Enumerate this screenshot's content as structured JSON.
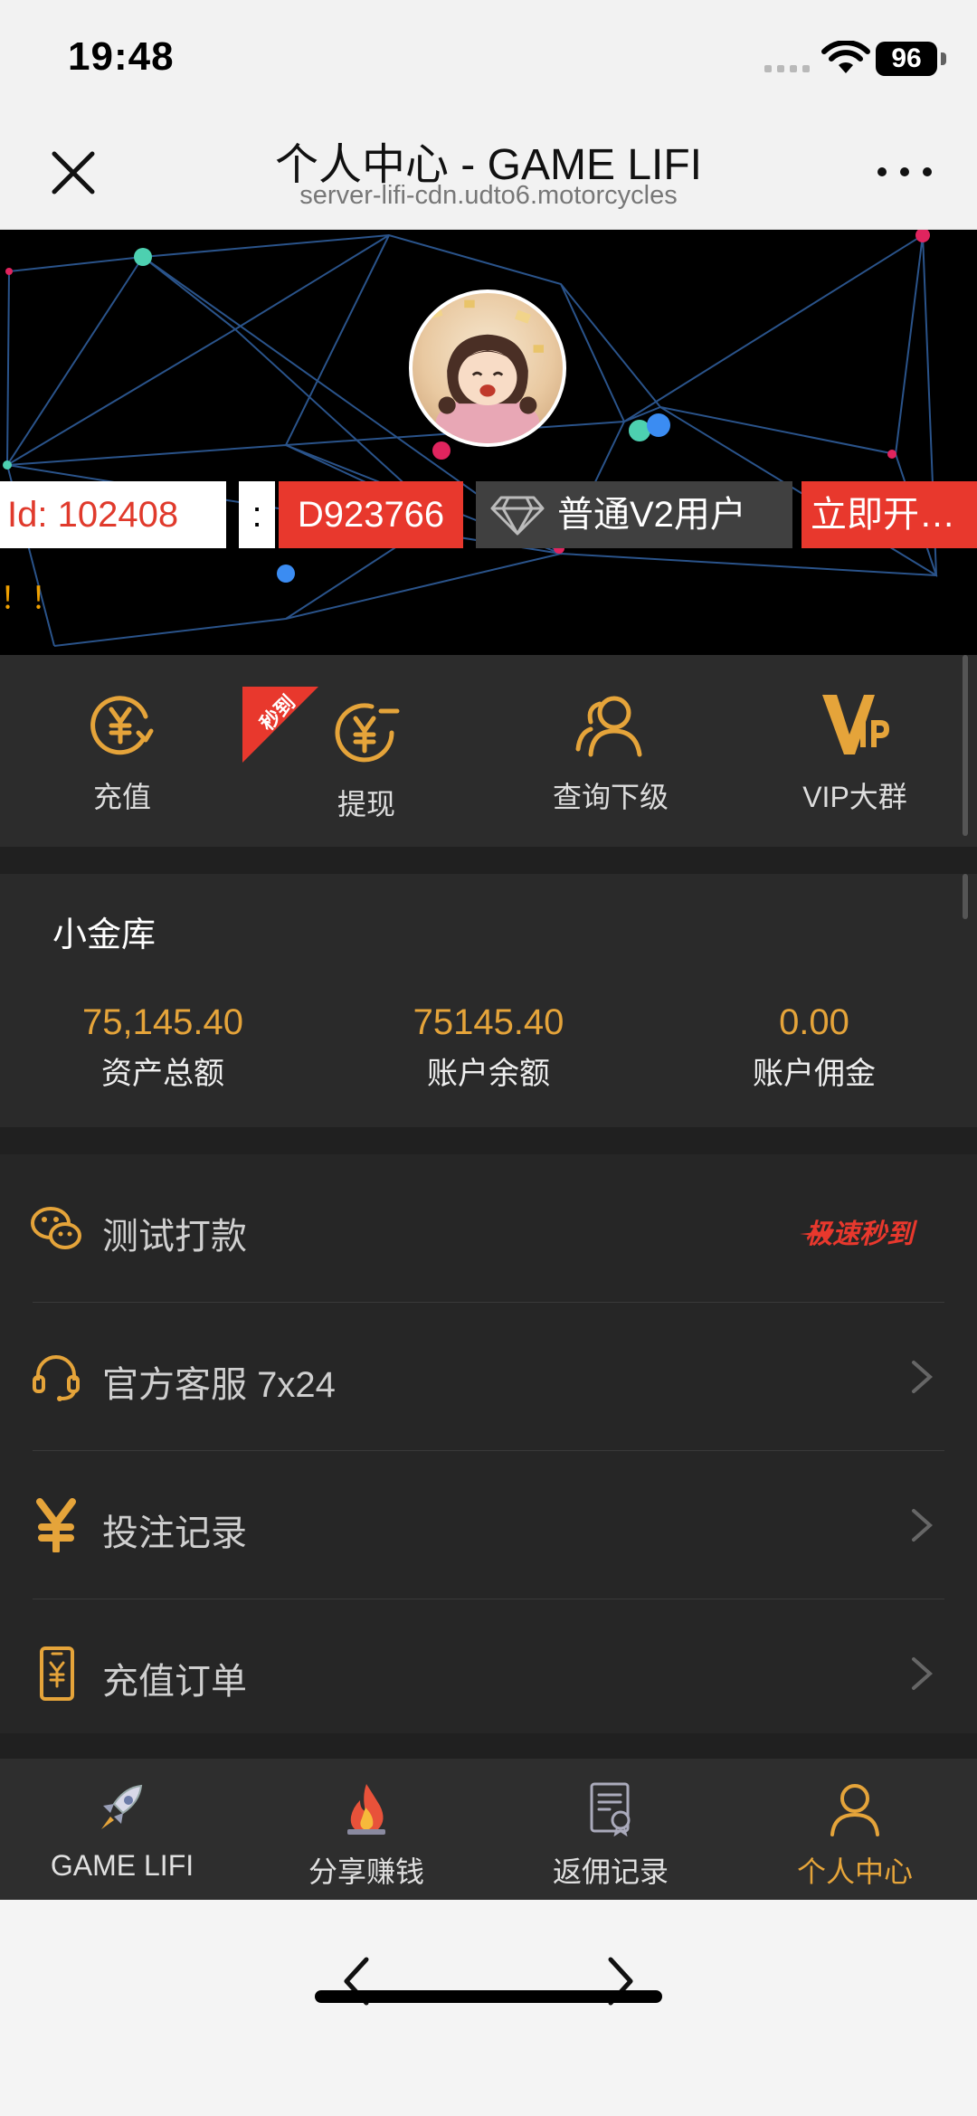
{
  "status": {
    "time": "19:48",
    "battery": "96"
  },
  "nav": {
    "title": "个人中心 - GAME LIFI",
    "subtitle": "server-lifi-cdn.udto6.motorcycles"
  },
  "profile": {
    "id_label": "Id:  102408",
    "colon": ":",
    "code": "D923766",
    "level": "普通V2用户",
    "open_label": "立即开…",
    "marquee": "！！"
  },
  "actions": [
    {
      "label": "充值",
      "icon": "yen-recharge-icon"
    },
    {
      "label": "提现",
      "icon": "yen-withdraw-icon",
      "badge": "秒到"
    },
    {
      "label": "查询下级",
      "icon": "users-icon"
    },
    {
      "label": "VIP大群",
      "icon": "vip-icon"
    }
  ],
  "vault": {
    "title": "小金库",
    "stats": [
      {
        "value": "75,145.40",
        "label": "资产总额"
      },
      {
        "value": "75145.40",
        "label": "账户余额"
      },
      {
        "value": "0.00",
        "label": "账户佣金"
      }
    ]
  },
  "menu": [
    {
      "label": "测试打款",
      "icon": "wechat-icon",
      "tag": "极速秒到"
    },
    {
      "label": "官方客服 7x24",
      "icon": "headset-icon"
    },
    {
      "label": "投注记录",
      "icon": "yen-icon"
    },
    {
      "label": "充值订单",
      "icon": "order-icon"
    }
  ],
  "tabs": [
    {
      "label": "GAME LIFI",
      "icon": "rocket-icon"
    },
    {
      "label": "分享赚钱",
      "icon": "fire-icon"
    },
    {
      "label": "返佣记录",
      "icon": "report-icon"
    },
    {
      "label": "个人中心",
      "icon": "user-icon",
      "active": true
    }
  ],
  "colors": {
    "accent": "#e5a43a",
    "red": "#e8382d",
    "bg": "#202020"
  }
}
